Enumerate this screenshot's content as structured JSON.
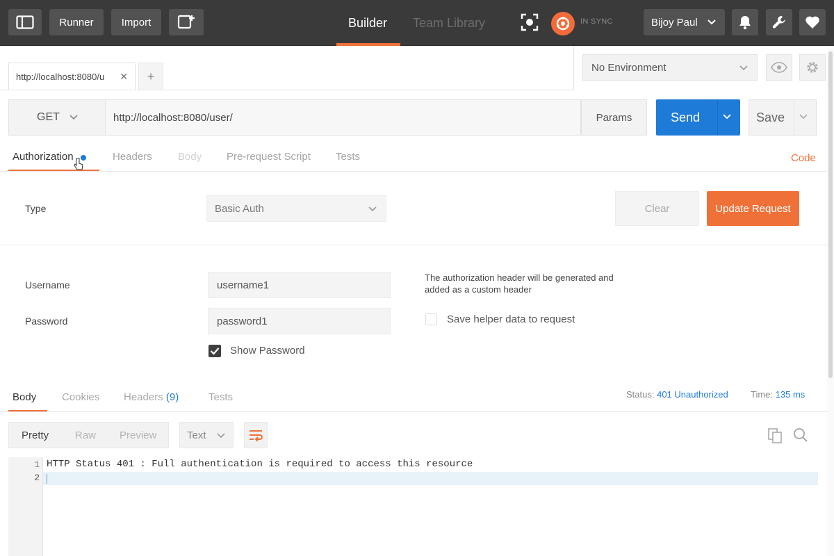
{
  "topbar": {
    "runner_label": "Runner",
    "import_label": "Import",
    "nav_builder": "Builder",
    "nav_team_library": "Team Library",
    "sync_status": "IN SYNC",
    "user_name": "Bijoy Paul"
  },
  "tabs": {
    "request_tab_label": "http://localhost:8080/u",
    "add_tab_symbol": "+"
  },
  "environment": {
    "selected": "No Environment"
  },
  "request": {
    "method": "GET",
    "url": "http://localhost:8080/user/",
    "params_label": "Params",
    "send_label": "Send",
    "save_label": "Save"
  },
  "subtabs": {
    "authorization": "Authorization",
    "headers": "Headers",
    "body": "Body",
    "prerequest": "Pre-request Script",
    "tests": "Tests",
    "code": "Code"
  },
  "auth": {
    "type_label": "Type",
    "type_value": "Basic Auth",
    "clear_label": "Clear",
    "update_label": "Update Request",
    "username_label": "Username",
    "username_value": "username1",
    "password_label": "Password",
    "password_value": "password1",
    "help_text": "The authorization header will be generated and added as a custom header",
    "save_helper_label": "Save helper data to request",
    "save_helper_checked": false,
    "show_password_label": "Show Password",
    "show_password_checked": true
  },
  "response": {
    "tabs": {
      "body": "Body",
      "cookies": "Cookies",
      "headers": "Headers",
      "headers_count": "(9)",
      "tests": "Tests"
    },
    "status_label": "Status:",
    "status_value": "401 Unauthorized",
    "time_label": "Time:",
    "time_value": "135 ms",
    "formats": {
      "pretty": "Pretty",
      "raw": "Raw",
      "preview": "Preview"
    },
    "content_type": "Text",
    "lines": [
      {
        "num": "1",
        "text": "HTTP Status 401 : Full authentication is required to access this resource"
      },
      {
        "num": "2",
        "text": ""
      }
    ]
  },
  "colors": {
    "accent_orange": "#f07138",
    "send_blue": "#1f7bd8",
    "topbar_bg": "#3a3a3a"
  }
}
